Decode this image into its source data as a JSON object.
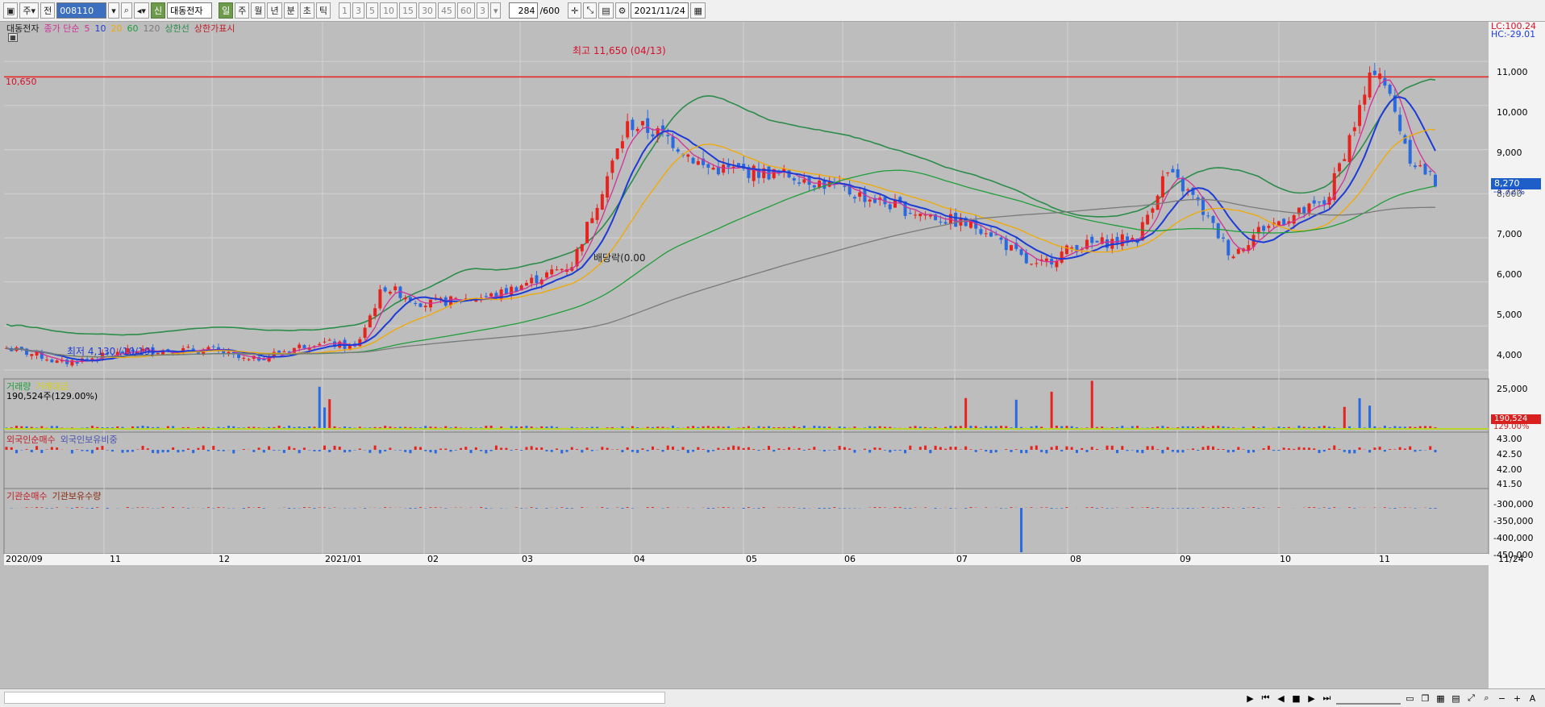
{
  "toolbar": {
    "period_unit": "주",
    "view_mode": "전",
    "stock_code": "008110",
    "stock_name": "대동전자",
    "badge": "신",
    "periods": [
      "일",
      "주",
      "월",
      "년",
      "분",
      "초",
      "틱"
    ],
    "active_period": "일",
    "intervals": [
      "1",
      "3",
      "5",
      "10",
      "15",
      "30",
      "45",
      "60",
      "3"
    ],
    "count_value": "284",
    "count_total": "/600",
    "date": "2021/11/24"
  },
  "legend": {
    "stock": "대동전자",
    "ma_label": "종가 단순",
    "ma_periods": [
      "5",
      "10",
      "20",
      "60",
      "120"
    ],
    "ma_colors": [
      "#d0309a",
      "#1d3bd6",
      "#f2a900",
      "#1f9e3a",
      "#7a7a7a"
    ],
    "envelope": "상한선",
    "upper_limit": "상한가표시"
  },
  "price_panel": {
    "lc": "LC:100.24",
    "hc": "HC:-29.01",
    "ref_line_value": "10,650",
    "high_annot": "최고 11,650 (04/13)",
    "low_annot": "최저 4,130 (10/19)",
    "dividend_annot": "배당락(0.00",
    "current_price": "8,270",
    "current_change": "-4.72%",
    "y_ticks": [
      "11,000",
      "10,000",
      "9,000",
      "8,000",
      "7,000",
      "6,000",
      "5,000",
      "4,000"
    ]
  },
  "volume_panel": {
    "title1": "거래량",
    "title2": "거래대금",
    "info": "190,524주(129.00%)",
    "current": "190,524",
    "current_pct": "129.00%",
    "y_ticks": [
      "25,000"
    ]
  },
  "foreign_panel": {
    "title1": "외국인순매수",
    "title2": "외국인보유비중",
    "y_ticks": [
      "43.00",
      "42.50",
      "42.00",
      "41.50"
    ]
  },
  "inst_panel": {
    "title1": "기관순매수",
    "title2": "기관보유수량",
    "y_ticks": [
      "-300,000",
      "-350,000",
      "-400,000",
      "-450,000"
    ]
  },
  "x_axis": {
    "labels": [
      "2020/09",
      "11",
      "12",
      "2021/01",
      "02",
      "03",
      "04",
      "05",
      "06",
      "07",
      "08",
      "09",
      "10",
      "11"
    ],
    "right_label": "11/24"
  },
  "colors": {
    "up": "#e8231e",
    "down": "#2a6ae0",
    "ref_line": "#e8231e",
    "upper_band": "#2c8c4a"
  },
  "chart_data": {
    "type": "candlestick",
    "title": "대동전자",
    "ylim": [
      3800,
      11900
    ],
    "moving_averages": [
      "5",
      "10",
      "20",
      "60",
      "120"
    ],
    "series": [
      {
        "name": "종가",
        "x": [
          "2020/09",
          "2020/10",
          "2020/11",
          "2020/12",
          "2021/01",
          "2021/02",
          "2021/03",
          "2021/04",
          "2021/05",
          "2021/06",
          "2021/07",
          "2021/08",
          "2021/09",
          "2021/10",
          "2021/11"
        ],
        "values": [
          4500,
          4300,
          4400,
          4450,
          4600,
          5700,
          5700,
          6700,
          8800,
          8400,
          7600,
          7000,
          7100,
          6800,
          8270
        ]
      }
    ],
    "highest": {
      "value": 11650,
      "date": "04/13"
    },
    "lowest": {
      "value": 4130,
      "date": "10/19"
    }
  }
}
